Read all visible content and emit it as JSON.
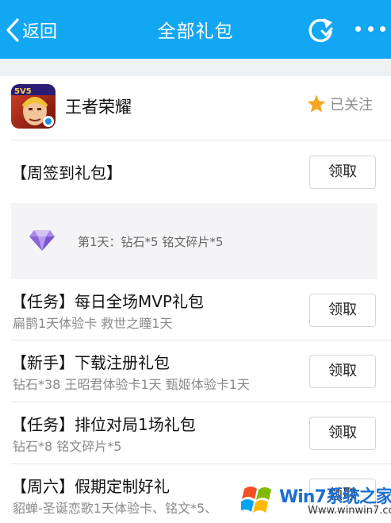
{
  "header": {
    "back_label": "返回",
    "title": "全部礼包"
  },
  "game": {
    "name": "王者荣耀",
    "follow_label": "已关注"
  },
  "gifts": [
    {
      "title": "【周签到礼包】",
      "button": "领取"
    },
    {
      "title": "【任务】每日全场MVP礼包",
      "subtitle": "扁鹊1天体验卡 救世之瞳1天",
      "button": "领取"
    },
    {
      "title": "【新手】下载注册礼包",
      "subtitle": "钻石*38 王昭君体验卡1天 甄姬体验卡1天",
      "button": "领取"
    },
    {
      "title": "【任务】排位对局1场礼包",
      "subtitle": "钻石*8 铭文碎片*5",
      "button": "领取"
    },
    {
      "title": "【周六】假期定制好礼",
      "subtitle": "貂蝉-圣诞恋歌1天体验卡、铭文*5、",
      "button": "领取"
    }
  ],
  "daily_reward": {
    "text": "第1天：钻石*5 铭文碎片*5"
  },
  "colors": {
    "topbar": "#12a7f3",
    "star": "#f5a623",
    "gem": "#9b7be0"
  },
  "watermark": {
    "brand": "Win7系统之家",
    "url": "Www.winwin7.com"
  }
}
